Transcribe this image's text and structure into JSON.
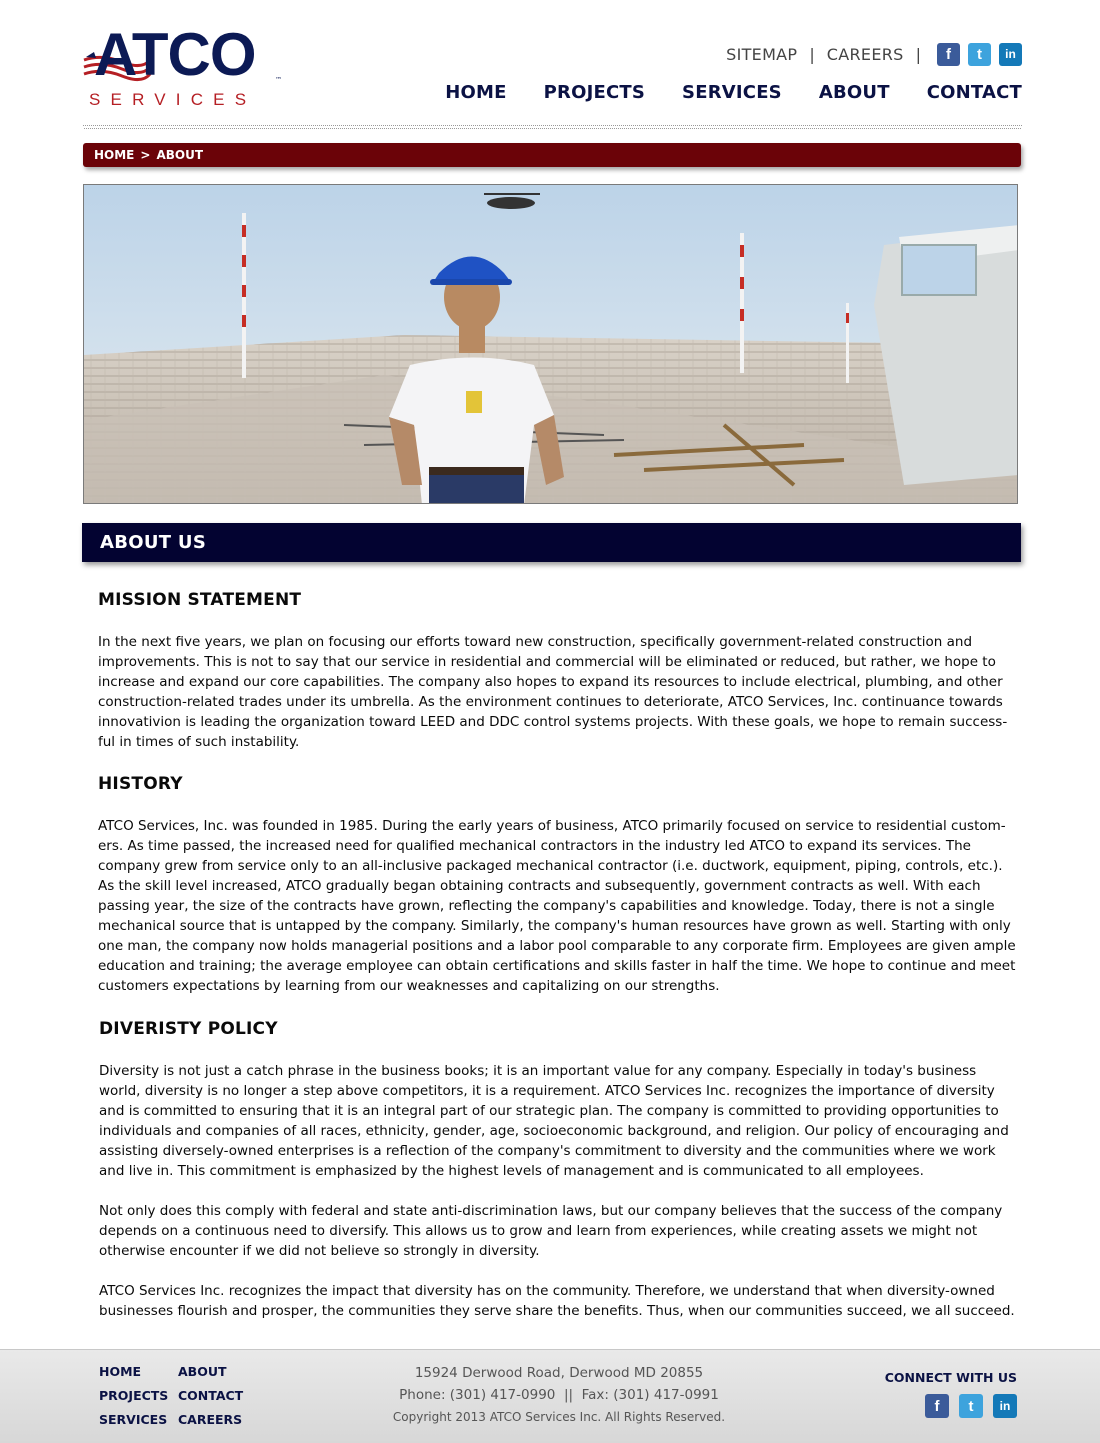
{
  "brand": {
    "logo_word": "ATCO",
    "logo_sub": "SERVICES",
    "logo_tm": "™",
    "colors": {
      "navy": "#0c1a55",
      "red": "#b51f24",
      "crumb": "#6b0308",
      "bar": "#030331"
    }
  },
  "toplinks": {
    "sitemap": "SITEMAP",
    "careers": "CAREERS",
    "separator": "|"
  },
  "social": {
    "facebook": "facebook-icon",
    "twitter": "twitter-icon",
    "linkedin": "linkedin-icon"
  },
  "nav": {
    "home": "HOME",
    "projects": "PROJECTS",
    "services": "SERVICES",
    "about": "ABOUT",
    "contact": "CONTACT"
  },
  "breadcrumb": {
    "home": "HOME",
    "separator": ">",
    "current": "ABOUT"
  },
  "about_bar": {
    "title": "ABOUT US"
  },
  "sections": {
    "mission": {
      "title": "MISSION STATEMENT",
      "text": "In the next five years, we plan on focusing our efforts toward new construction, specifically government-related construction and improvements. This is not to say that our service in residential and commercial will be eliminated or reduced, but rather, we hope to increase and expand our core capabilities. The company also hopes to expand its resources to include electrical, plumbing, and other construction-related trades under its umbrella. As the environment continues to deteriorate, ATCO Services, Inc. continuance towards innovativion is leading the organization toward LEED and DDC control systems projects. With these goals, we hope to remain success-ful in times of such instability."
    },
    "history": {
      "title": "HISTORY",
      "text": "ATCO Services, Inc. was founded in 1985. During the early years of business, ATCO primarily focused on service to residential custom-ers. As time passed, the increased need for qualified mechanical contractors in the industry led ATCO to expand its services. The company grew from service only to an all-inclusive packaged mechanical contractor (i.e. ductwork, equipment, piping, controls, etc.). As the skill level increased, ATCO gradually began obtaining contracts and subsequently, government contracts as well. With each passing year, the size of the contracts have grown, reflecting the company's capabilities and knowledge. Today, there is not a single mechanical source that is untapped by the company. Similarly, the company's human resources have grown as well. Starting with only one man, the company now holds managerial positions and a labor pool comparable to any corporate firm. Employees are given ample education and training; the average employee can obtain certifications and skills faster in half the time. We hope to continue and meet customers expectations by learning from our weaknesses and capitalizing on our strengths."
    },
    "diversity": {
      "title": "DIVERISTY POLICY",
      "p1": "Diversity is not just a catch phrase in the business books; it is an important value for any company. Especially in today's business world, diversity is no longer a step above competitors, it is a requirement. ATCO Services Inc. recognizes the importance of diversity and is committed to ensuring that it is an integral part of our strategic plan. The company is committed to providing opportunities to individuals and companies of all races, ethnicity, gender, age, socioeconomic background, and religion. Our policy of encouraging and assisting diversely-owned enterprises is a reflection of the company's commitment to diversity and the communities where we work and live in. This commitment is emphasized by the highest levels of management and is communicated to all employees.",
      "p2": "Not only does this comply with federal and state anti-discrimination laws, but our company believes that the success of the company depends on a continuous need to diversify. This allows us to grow and learn from experiences, while creating assets we might not otherwise encounter if we did not believe so strongly in diversity.",
      "p3": "ATCO Services Inc. recognizes the impact that diversity has on the community. Therefore, we understand that when diversity-owned businesses flourish and prosper, the communities they serve share the benefits. Thus, when our communities succeed, we all succeed."
    }
  },
  "footer": {
    "nav": {
      "home": "HOME",
      "about": "ABOUT",
      "projects": "PROJECTS",
      "contact": "CONTACT",
      "services": "SERVICES",
      "careers": "CAREERS"
    },
    "address": "15924 Derwood Road, Derwood MD 20855",
    "phone": "Phone: (301) 417-0990  ||  Fax: (301) 417-0991",
    "copyright": "Copyright 2013 ATCO Services Inc. All Rights Reserved.",
    "connect": "CONNECT WITH US"
  }
}
